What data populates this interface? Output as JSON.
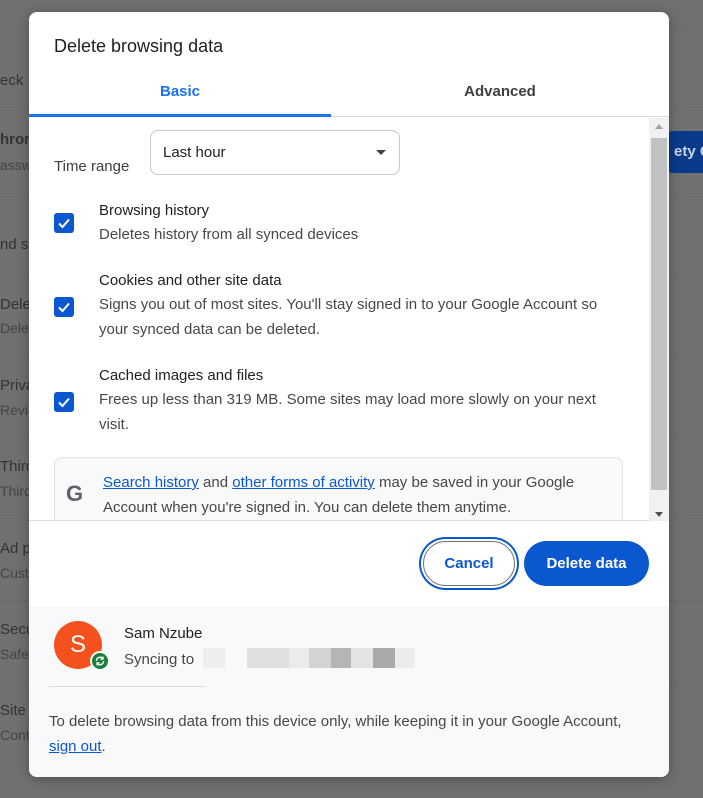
{
  "background": {
    "fragments": [
      "eck",
      "hron",
      "assw",
      "nd s",
      "Delet",
      "Delet",
      "Priva",
      "Revie",
      "Third",
      "Third",
      "Ad p",
      "Custo",
      "Secu",
      "Safe",
      "Site s",
      "Cont"
    ],
    "safety_check_button": "ety Ch"
  },
  "dialog": {
    "title": "Delete browsing data",
    "tabs": [
      {
        "label": "Basic",
        "active": true
      },
      {
        "label": "Advanced",
        "active": false
      }
    ],
    "time_range": {
      "label": "Time range",
      "value": "Last hour"
    },
    "options": [
      {
        "title": "Browsing history",
        "description": "Deletes history from all synced devices",
        "checked": true
      },
      {
        "title": "Cookies and other site data",
        "description": "Signs you out of most sites. You'll stay signed in to your Google Account so your synced data can be deleted.",
        "checked": true
      },
      {
        "title": "Cached images and files",
        "description": "Frees up less than 319 MB. Some sites may load more slowly on your next visit.",
        "checked": true
      }
    ],
    "info": {
      "link1": "Search history",
      "mid": "and",
      "link2": "other forms of activity",
      "rest": "may be saved in your Google Account when you're signed in. You can delete them anytime."
    },
    "buttons": {
      "cancel": "Cancel",
      "delete": "Delete data"
    },
    "account": {
      "initial": "S",
      "name": "Sam Nzube",
      "sync_label": "Syncing to",
      "avatar_color": "#f4511e"
    },
    "footer": {
      "note_prefix": "To delete browsing data from this device only, while keeping it in your Google Account,",
      "sign_out": "sign out",
      "note_suffix": "."
    }
  },
  "colors": {
    "accent": "#0b57d0",
    "tab_accent": "#1a73e8"
  }
}
